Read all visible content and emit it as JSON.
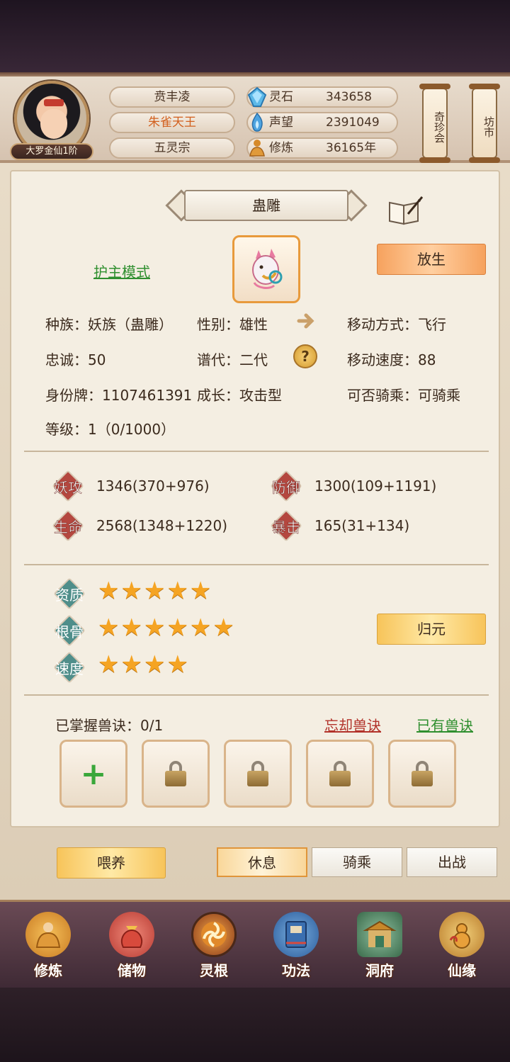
{
  "header": {
    "rank_badge": "大罗金仙1阶",
    "player_name": "贲丰凌",
    "title": "朱雀天王",
    "sect": "五灵宗",
    "resources": [
      {
        "label": "灵石",
        "value": "343658",
        "icon": "spirit-stone-icon"
      },
      {
        "label": "声望",
        "value": "2391049",
        "icon": "reputation-flame-icon"
      },
      {
        "label": "修炼",
        "value": "36165年",
        "icon": "meditation-icon"
      }
    ],
    "shops": [
      "奇珍会",
      "坊市"
    ]
  },
  "pet": {
    "name": "蛊雕",
    "guard_mode_link": "护主模式",
    "release_button": "放生",
    "info": {
      "race": "种族：妖族（蛊雕）",
      "gender": "性别：雄性",
      "move_type": "移动方式：飞行",
      "loyalty": "忠诚：50",
      "generation": "谱代：二代",
      "move_speed": "移动速度：88",
      "id_tag": "身份牌：1107461391",
      "growth": "成长：攻击型",
      "rideable": "可否骑乘：可骑乘",
      "level": "等级：1（0/1000）"
    },
    "stats": [
      {
        "label": "妖攻",
        "value": "1346(370+976)"
      },
      {
        "label": "防御",
        "value": "1300(109+1191)"
      },
      {
        "label": "生命",
        "value": "2568(1348+1220)"
      },
      {
        "label": "暴击",
        "value": "165(31+134)"
      }
    ],
    "qualities": [
      {
        "label": "资质",
        "stars": 5,
        "stars_text": "★★★★★"
      },
      {
        "label": "根骨",
        "stars": 6,
        "stars_text": "★★★★★★"
      },
      {
        "label": "速度",
        "stars": 4,
        "stars_text": "★★★★"
      }
    ],
    "reset_button": "归元",
    "skills": {
      "mastered": "已掌握兽诀：0/1",
      "forget_link": "忘却兽诀",
      "owned_link": "已有兽诀"
    },
    "actions": {
      "feed": "喂养",
      "tabs": [
        "休息",
        "骑乘",
        "出战"
      ],
      "active_tab": "休息"
    }
  },
  "nav": [
    "修炼",
    "储物",
    "灵根",
    "功法",
    "洞府",
    "仙缘"
  ],
  "colors": {
    "accent_orange": "#f6a25e",
    "link_green": "#2f8f2f",
    "link_red": "#b2322a",
    "star": "#f5a423"
  }
}
